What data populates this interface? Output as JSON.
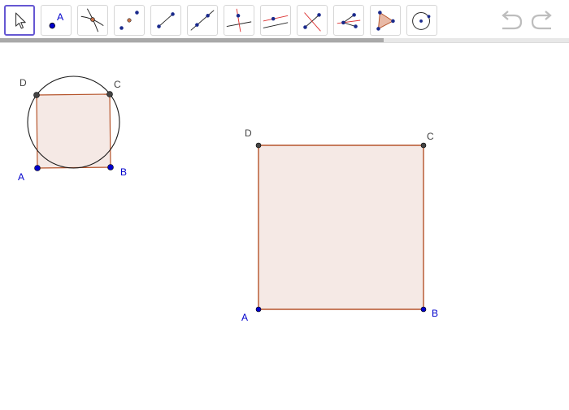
{
  "toolbar": {
    "tools": [
      {
        "name": "move-tool",
        "icon": "cursor-icon",
        "selected": true
      },
      {
        "name": "point-tool",
        "icon": "point-icon",
        "label": "A"
      },
      {
        "name": "intersect-tool",
        "icon": "intersect-icon"
      },
      {
        "name": "midpoint-tool",
        "icon": "midpoint-icon"
      },
      {
        "name": "segment-tool",
        "icon": "segment-icon"
      },
      {
        "name": "line-tool",
        "icon": "line-icon"
      },
      {
        "name": "perpendicular-line-tool",
        "icon": "perpendicular-icon"
      },
      {
        "name": "parallel-line-tool",
        "icon": "parallel-icon"
      },
      {
        "name": "perpendicular-bisector-tool",
        "icon": "bisector-icon"
      },
      {
        "name": "angle-bisector-tool",
        "icon": "angle-bisector-icon"
      },
      {
        "name": "polygon-tool",
        "icon": "polygon-icon"
      },
      {
        "name": "circle-tool",
        "icon": "circle-icon"
      }
    ],
    "undo_icon": "undo-icon",
    "redo_icon": "redo-icon"
  },
  "construction_small": {
    "points": {
      "A": "A",
      "B": "B",
      "C": "C",
      "D": "D"
    }
  },
  "construction_large": {
    "points": {
      "A": "A",
      "B": "B",
      "C": "C",
      "D": "D"
    }
  },
  "colors": {
    "accent": "#6557d2",
    "free_point": "#0000cc",
    "dependent_point": "#444444",
    "polygon_stroke": "#b5542b",
    "polygon_fill": "#f5e9e5",
    "label_blue": "#0000cc"
  }
}
